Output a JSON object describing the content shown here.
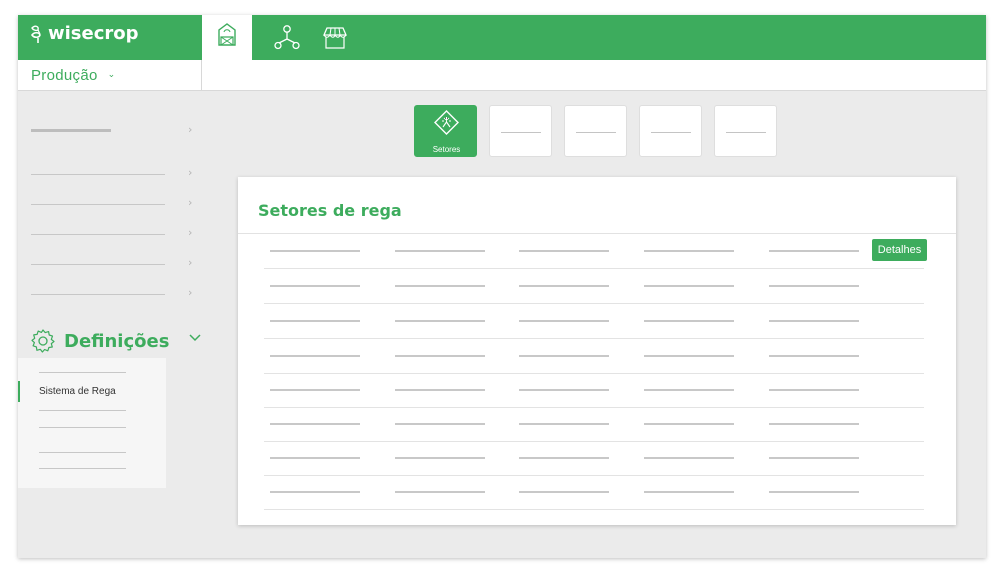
{
  "app": {
    "logo_text": "wisecrop"
  },
  "top_nav": {
    "items": [
      {
        "icon": "greenhouse-icon",
        "active": true
      },
      {
        "icon": "network-icon",
        "active": false
      },
      {
        "icon": "market-stall-icon",
        "active": false
      }
    ]
  },
  "production_select": {
    "value": "Produção"
  },
  "sidebar": {
    "definicoes": {
      "label": "Definições",
      "icon": "gear-icon"
    },
    "submenu": {
      "active_label": "Sistema de Rega"
    }
  },
  "tabs": [
    {
      "label": "Setores",
      "icon": "sprinkler-icon",
      "active": true
    },
    {
      "label": "",
      "active": false
    },
    {
      "label": "",
      "active": false
    },
    {
      "label": "",
      "active": false
    },
    {
      "label": "",
      "active": false
    }
  ],
  "card": {
    "title": "Setores de rega",
    "details_label": "Detalhes",
    "row_count": 8
  },
  "colors": {
    "accent": "#3dac5d",
    "background": "#ebebeb"
  }
}
